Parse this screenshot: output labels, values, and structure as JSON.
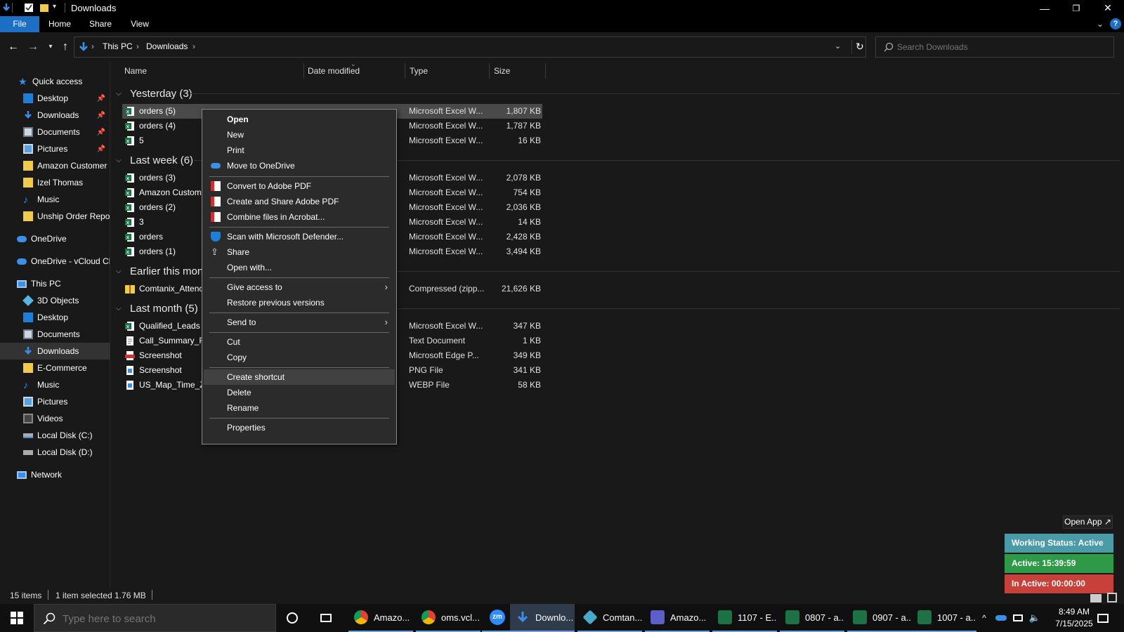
{
  "window": {
    "title": "Downloads",
    "buttons": {
      "minimize": "—",
      "maximize": "❐",
      "close": "✕"
    }
  },
  "ribbon": {
    "tabs": [
      {
        "label": "File"
      },
      {
        "label": "Home"
      },
      {
        "label": "Share"
      },
      {
        "label": "View"
      }
    ]
  },
  "address": {
    "segments": [
      "This PC",
      "Downloads"
    ]
  },
  "search": {
    "placeholder": "Search Downloads"
  },
  "sidebar": {
    "quick_access": "Quick access",
    "items": [
      {
        "label": "Desktop"
      },
      {
        "label": "Downloads"
      },
      {
        "label": "Documents"
      },
      {
        "label": "Pictures"
      },
      {
        "label": "Amazon Customer"
      },
      {
        "label": "Izel Thomas"
      },
      {
        "label": "Music"
      },
      {
        "label": "Unship Order Repor"
      },
      {
        "label": "OneDrive"
      },
      {
        "label": "OneDrive - vCloud Cl"
      },
      {
        "label": "This PC"
      },
      {
        "label": "3D Objects"
      },
      {
        "label": "Desktop"
      },
      {
        "label": "Documents"
      },
      {
        "label": "Downloads"
      },
      {
        "label": "E-Commerce"
      },
      {
        "label": "Music"
      },
      {
        "label": "Pictures"
      },
      {
        "label": "Videos"
      },
      {
        "label": "Local Disk (C:)"
      },
      {
        "label": "Local Disk (D:)"
      },
      {
        "label": "Network"
      }
    ]
  },
  "columns": {
    "name": "Name",
    "date": "Date modified",
    "type": "Type",
    "size": "Size"
  },
  "groups": [
    {
      "label": "Yesterday (3)",
      "rows": [
        {
          "name": "orders (5)",
          "type": "Microsoft Excel W...",
          "size": "1,807 KB"
        },
        {
          "name": "orders (4)",
          "type": "Microsoft Excel W...",
          "size": "1,787 KB"
        },
        {
          "name": "5",
          "type": "Microsoft Excel W...",
          "size": "16 KB"
        }
      ]
    },
    {
      "label": "Last week (6)",
      "rows": [
        {
          "name": "orders (3)",
          "type": "Microsoft Excel W...",
          "size": "2,078 KB"
        },
        {
          "name": "Amazon Custom",
          "type": "Microsoft Excel W...",
          "size": "754 KB"
        },
        {
          "name": "orders (2)",
          "type": "Microsoft Excel W...",
          "size": "2,036 KB"
        },
        {
          "name": "3",
          "type": "Microsoft Excel W...",
          "size": "14 KB"
        },
        {
          "name": "orders",
          "type": "Microsoft Excel W...",
          "size": "2,428 KB"
        },
        {
          "name": "orders (1)",
          "type": "Microsoft Excel W...",
          "size": "3,494 KB"
        }
      ]
    },
    {
      "label": "Earlier this mont",
      "rows": [
        {
          "name": "Comtanix_Attenc",
          "type": "Compressed (zipp...",
          "size": "21,626 KB"
        }
      ]
    },
    {
      "label": "Last month (5)",
      "rows": [
        {
          "name": "Qualified_Leads",
          "type": "Microsoft Excel W...",
          "size": "347 KB"
        },
        {
          "name": "Call_Summary_R",
          "type": "Text Document",
          "size": "1 KB"
        },
        {
          "name": "Screenshot",
          "type": "Microsoft Edge P...",
          "size": "349 KB"
        },
        {
          "name": "Screenshot",
          "type": "PNG File",
          "size": "341 KB"
        },
        {
          "name": "US_Map_Time_Zc",
          "type": "WEBP File",
          "size": "58 KB"
        }
      ]
    }
  ],
  "context_menu": {
    "items": [
      {
        "label": "Open"
      },
      {
        "label": "New"
      },
      {
        "label": "Print"
      },
      {
        "label": "Move to OneDrive"
      },
      {
        "label": "Convert to Adobe PDF"
      },
      {
        "label": "Create and Share Adobe PDF"
      },
      {
        "label": "Combine files in Acrobat..."
      },
      {
        "label": "Scan with Microsoft Defender..."
      },
      {
        "label": "Share"
      },
      {
        "label": "Open with..."
      },
      {
        "label": "Give access to"
      },
      {
        "label": "Restore previous versions"
      },
      {
        "label": "Send to"
      },
      {
        "label": "Cut"
      },
      {
        "label": "Copy"
      },
      {
        "label": "Create shortcut"
      },
      {
        "label": "Delete"
      },
      {
        "label": "Rename"
      },
      {
        "label": "Properties"
      }
    ]
  },
  "status": {
    "items": "15 items",
    "selected": "1 item selected  1.76 MB"
  },
  "tracker": {
    "open_app": "Open App ↗",
    "working": "Working Status: Active",
    "active": "Active: 15:39:59",
    "inactive": "In Active: 00:00:00",
    "colors": {
      "working": "#4a9aa8",
      "active": "#2e9a48",
      "inactive": "#c8403a"
    }
  },
  "taskbar": {
    "search_placeholder": "Type here to search",
    "apps": [
      {
        "label": "Amazo..."
      },
      {
        "label": "oms.vcl..."
      },
      {
        "label": "Downlo..."
      },
      {
        "label": "Comtan..."
      },
      {
        "label": "Amazo..."
      },
      {
        "label": "1107 - E..."
      },
      {
        "label": "0807 - a..."
      },
      {
        "label": "0907 - a..."
      },
      {
        "label": "1007 - a..."
      }
    ],
    "time": "8:49 AM",
    "date": "7/15/2025"
  },
  "colors": {
    "accent": "#1d6fc3",
    "excel_green": "#1e7145",
    "folder_yellow": "#f2c94c"
  }
}
